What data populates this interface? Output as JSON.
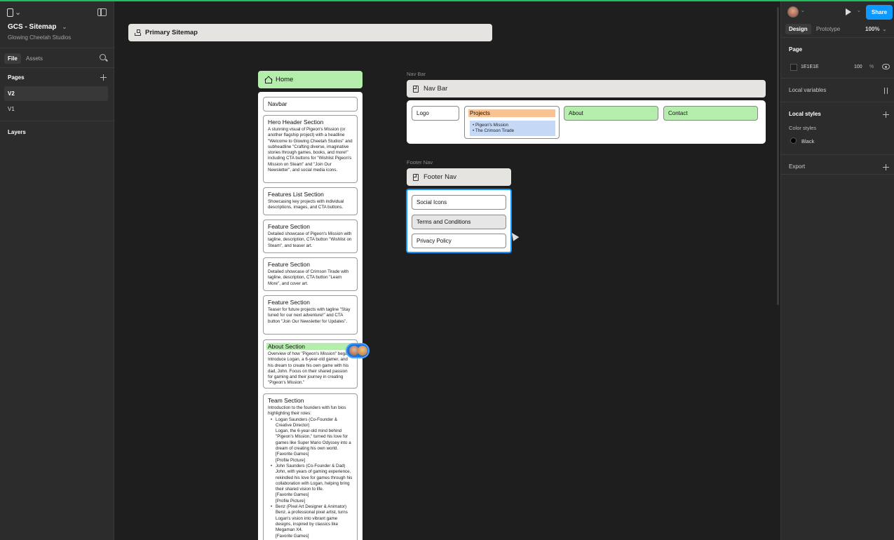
{
  "app": {
    "file_title": "GCS - Sitemap",
    "team": "Glowing Cheetah Studios"
  },
  "left_panel": {
    "tabs": [
      "File",
      "Assets"
    ],
    "pages_label": "Pages",
    "pages": [
      "V2",
      "V1"
    ],
    "layers_label": "Layers"
  },
  "right_panel": {
    "share_label": "Share",
    "tabs": [
      "Design",
      "Prototype"
    ],
    "zoom": "100%",
    "page_section": {
      "label": "Page",
      "color_hex": "1E1E1E",
      "opacity": "100",
      "opacity_unit": "%"
    },
    "local_variables_label": "Local variables",
    "local_styles_label": "Local styles",
    "color_styles_label": "Color styles",
    "color_style_name": "Black",
    "export_label": "Export"
  },
  "canvas": {
    "sitemap_title": "Primary Sitemap",
    "home": {
      "title": "Home",
      "cards": [
        {
          "title": "Navbar",
          "desc": ""
        },
        {
          "title": "Hero Header Section",
          "desc": "A stunning visual of Pigeon's Mission (or another flagship project) with a headline \"Welcome to Glowing Cheetah Studios\" and subheadline \"Crafting diverse, imaginative stories through games, books, and more!\" including CTA buttons for \"Wishlist Pigeon's Mission on Steam\" and \"Join Our Newsletter\", and social media icons."
        },
        {
          "title": "Features List Section",
          "desc": "Showcasing key projects with individual descriptions, images, and CTA buttons."
        },
        {
          "title": "Feature Section",
          "desc": "Detailed showcase of Pigeon's Mission with tagline, description, CTA button \"Wishlist on Steam\", and teaser art."
        },
        {
          "title": "Feature Section",
          "desc": "Detailed showcase of Crimson Tirade with tagline, description, CTA button \"Learn More\", and cover art."
        },
        {
          "title": "Feature Section",
          "desc": "Teaser for future projects with tagline \"Stay tuned for our next adventure!\" and CTA button \"Join Our Newsletter for Updates\"."
        },
        {
          "title": "About Section",
          "desc": "Overview of how \"Pigeon's Mission\" began. Introduce Logan, a 6-year-old gamer, and his dream to create his own game with his dad, John. Focus on their shared passion for gaming and their journey in creating \"Pigeon's Mission.\""
        }
      ],
      "team": {
        "title": "Team Section",
        "intro": "Introduction to the founders with fun bios highlighting their roles:",
        "members": [
          [
            "Logan Saunders (Co-Founder & Creative Director)",
            "Logan, the 6-year-old mind behind \"Pigeon's Mission,\" turned his love for games like Super Mario Odyssey into a dream of creating his own world.",
            "[Favorite Games]",
            "[Profile Picture]"
          ],
          [
            "John Saunders (Co-Founder & Dad)",
            "John, with years of gaming experience, rekindled his love for games through his collaboration with Logan, helping bring their shared vision to life.",
            "[Favorite Games]",
            "[Profile Picture]"
          ],
          [
            "Benz (Pixel Art Designer & Animator)",
            "Benz, a professional pixel artist, turns Logan's vision into vibrant game designs, inspired by classics like Megaman X4.",
            "[Favorite Games]"
          ]
        ]
      }
    },
    "nav_bar": {
      "frame_label": "Nav Bar",
      "title": "Nav Bar",
      "logo": "Logo",
      "projects": "Projects",
      "project_items": [
        "Pigeon's Mission",
        "The Crimson Tirade"
      ],
      "about": "About",
      "contact": "Contact"
    },
    "footer_nav": {
      "frame_label": "Footer Nav",
      "title": "Footer Nav",
      "items": [
        "Social Icons",
        "Terms and Conditions",
        "Privacy Policy"
      ]
    }
  },
  "colors": {
    "canvas_bg": "#1e1e1e",
    "panel_bg": "#2c2c2c",
    "accent_blue": "#0d99ff",
    "green_highlight": "#b5eeac",
    "orange_highlight": "#f8c292",
    "blue_highlight": "#c5d8f6"
  },
  "icons": [
    "figma-menu-icon",
    "sidebar-toggle-icon",
    "search-icon",
    "plus-icon",
    "play-icon",
    "eye-icon",
    "variables-icon",
    "sitemap-icon",
    "house-icon",
    "frame-icon"
  ]
}
